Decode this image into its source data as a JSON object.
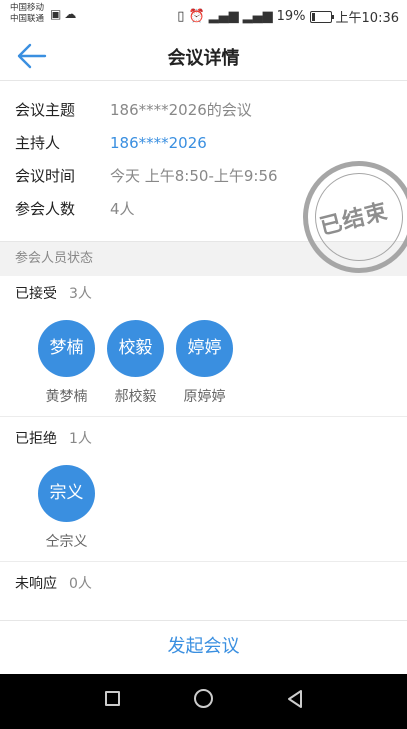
{
  "status_bar": {
    "carrier1": "中国移动",
    "carrier2": "中国联通",
    "battery_percent": "19%",
    "time": "上午10:36",
    "battery_level": 0.19
  },
  "nav": {
    "title": "会议详情"
  },
  "meeting": {
    "topic_label": "会议主题",
    "topic_value": "186****2026的会议",
    "host_label": "主持人",
    "host_value": "186****2026",
    "time_label": "会议时间",
    "time_value": "今天  上午8:50-上午9:56",
    "count_label": "参会人数",
    "count_value": "4人",
    "stamp_text": "已结束"
  },
  "participants": {
    "section_title": "参会人员状态",
    "accepted": {
      "label": "已接受",
      "count": "3人",
      "people": [
        {
          "avatar": "梦楠",
          "name": "黄梦楠"
        },
        {
          "avatar": "校毅",
          "name": "郝校毅"
        },
        {
          "avatar": "婷婷",
          "name": "原婷婷"
        }
      ]
    },
    "rejected": {
      "label": "已拒绝",
      "count": "1人",
      "people": [
        {
          "avatar": "宗义",
          "name": "仝宗义"
        }
      ]
    },
    "no_response": {
      "label": "未响应",
      "count": "0人"
    }
  },
  "actions": {
    "start_meeting": "发起会议"
  },
  "colors": {
    "accent": "#3a8fe0",
    "stamp": "#a6a6a6"
  }
}
